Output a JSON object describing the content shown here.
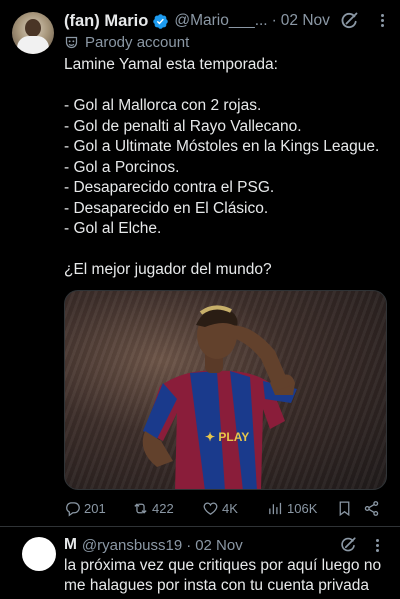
{
  "tweet": {
    "display_name": "(fan) Mario",
    "handle": "@Mario___...",
    "separator": "·",
    "date": "02 Nov",
    "label": "Parody account",
    "lines": [
      "Lamine Yamal esta temporada:",
      "",
      "- Gol al Mallorca con 2 rojas.",
      "- Gol de penalti al Rayo Vallecano.",
      "- Gol a Ultimate Móstoles en la Kings League.",
      "- Gol a Porcinos.",
      "- Desaparecido contra el PSG.",
      "- Desaparecido en El Clásico.",
      "- Gol al Elche.",
      "",
      "¿El mejor jugador del mundo?"
    ],
    "stats": {
      "replies": "201",
      "reposts": "422",
      "likes": "4K",
      "views": "106K"
    },
    "icons": [
      "verified-badge-icon",
      "grok-icon",
      "more-icon",
      "parody-mask-icon",
      "reply-icon",
      "repost-icon",
      "like-icon",
      "views-icon",
      "bookmark-icon",
      "share-icon"
    ],
    "colors": {
      "background": "#000000",
      "text": "#e7e9ea",
      "muted": "#8b98a5",
      "verified": "#1d9bf0"
    }
  },
  "reply": {
    "display_name": "M",
    "handle": "@ryansbuss19",
    "separator": "·",
    "date": "02 Nov",
    "text": "la próxima vez que critiques por aquí luego no me halagues por insta con tu cuenta privada"
  }
}
